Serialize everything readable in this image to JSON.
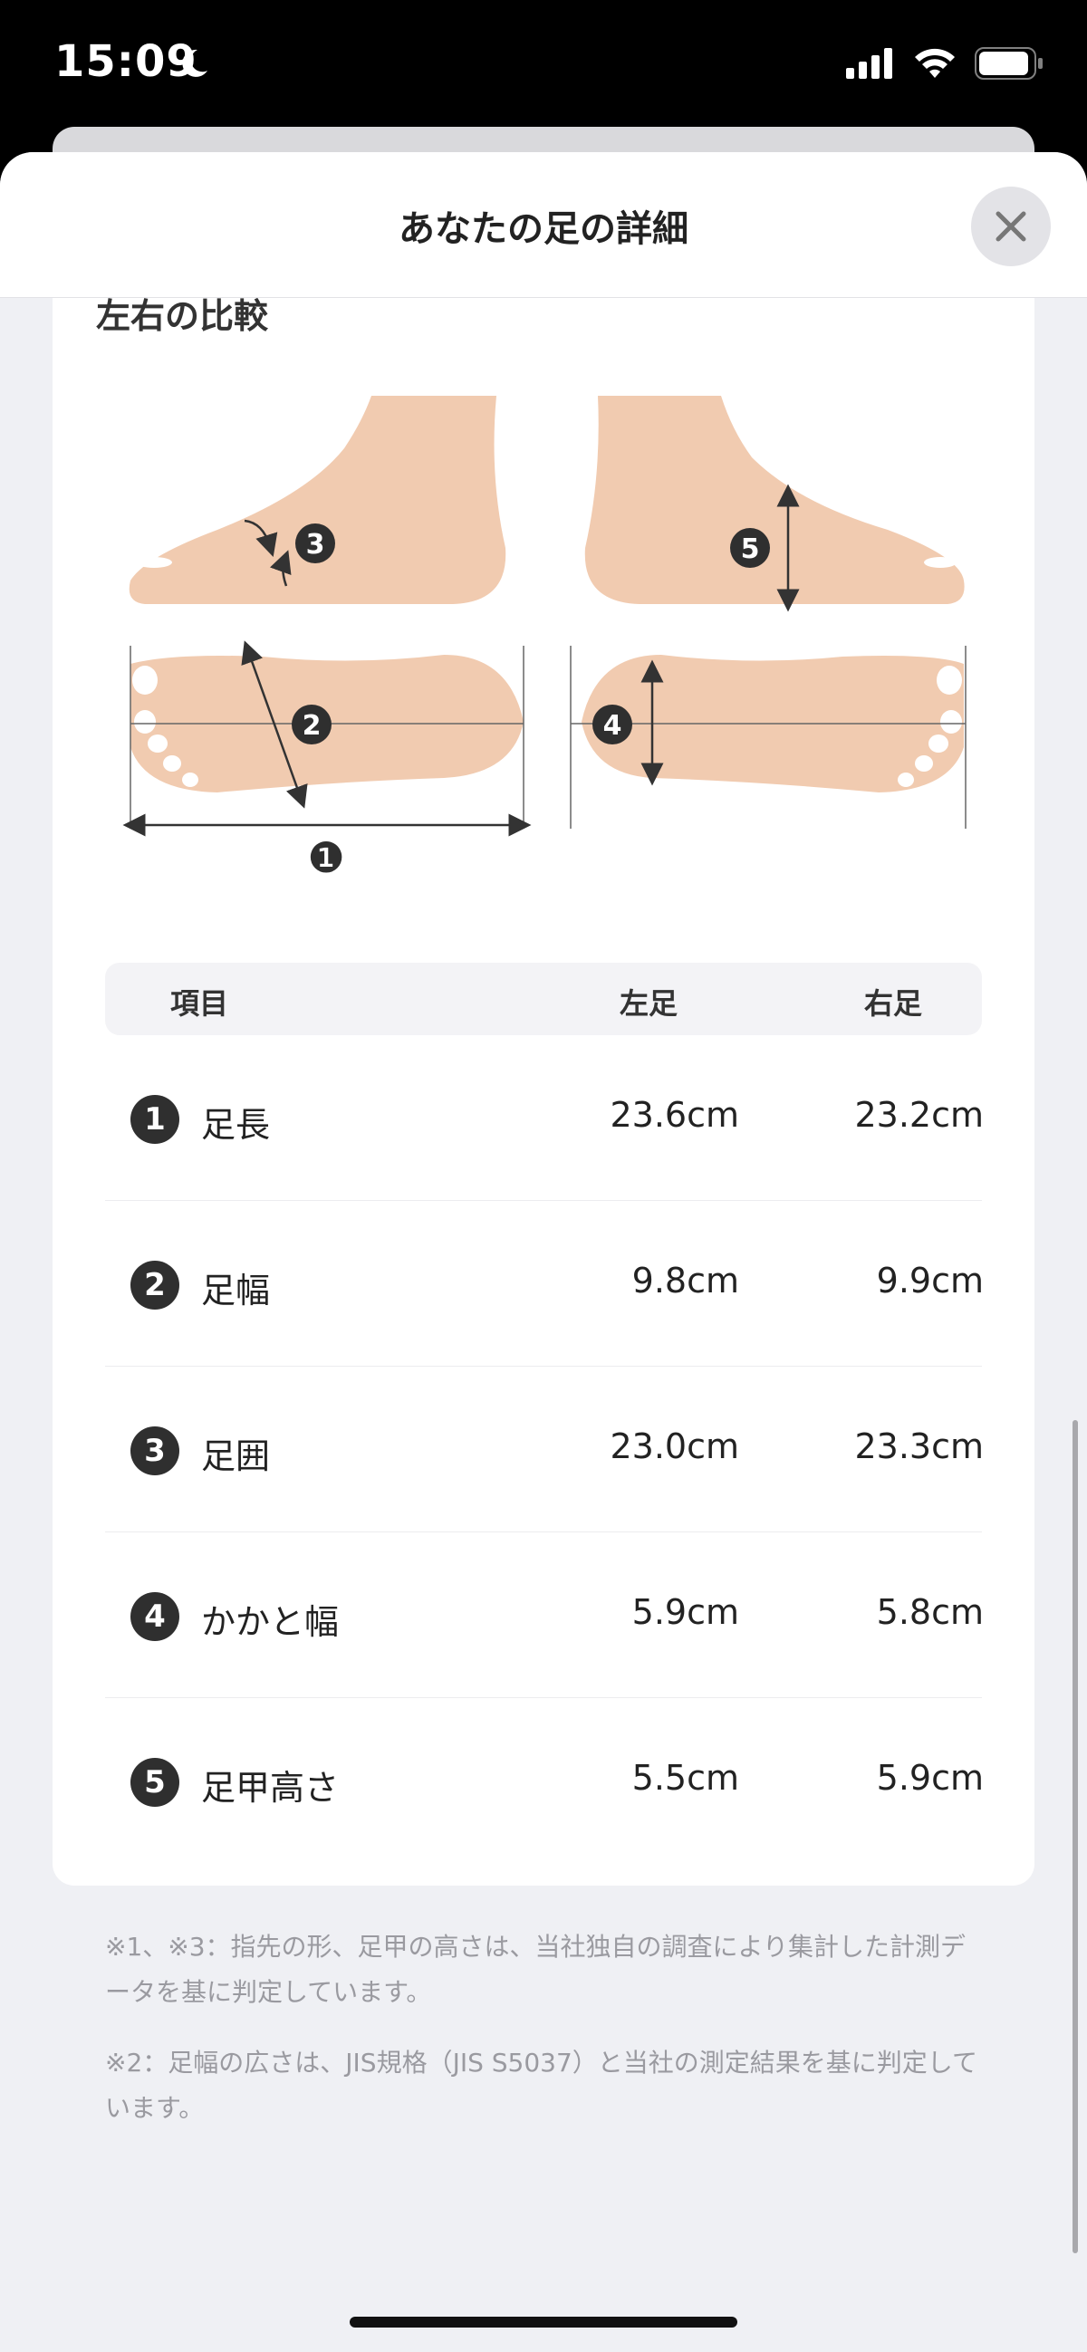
{
  "status_bar": {
    "time": "15:09"
  },
  "sheet": {
    "title": "あなたの足の詳細"
  },
  "section": {
    "heading": "左右の比較"
  },
  "diagram": {
    "markers": [
      "❶",
      "2",
      "3",
      "4",
      "5"
    ]
  },
  "table": {
    "headers": {
      "item": "項目",
      "left": "左足",
      "right": "右足"
    },
    "rows": [
      {
        "num": "1",
        "label": "足長",
        "left": "23.6cm",
        "right": "23.2cm"
      },
      {
        "num": "2",
        "label": "足幅",
        "left": "9.8cm",
        "right": "9.9cm"
      },
      {
        "num": "3",
        "label": "足囲",
        "left": "23.0cm",
        "right": "23.3cm"
      },
      {
        "num": "4",
        "label": "かかと幅",
        "left": "5.9cm",
        "right": "5.8cm"
      },
      {
        "num": "5",
        "label": "足甲高さ",
        "left": "5.5cm",
        "right": "5.9cm"
      }
    ]
  },
  "notes": [
    "※1、※3：指先の形、足甲の高さは、当社独自の調査により集計した計測データを基に判定しています。",
    "※2：足幅の広さは、JIS規格（JIS S5037）と当社の測定結果を基に判定しています。"
  ],
  "colors": {
    "skin": "#f1cbb0",
    "badge": "#2f2f2f",
    "note_text": "#9a9aa0"
  }
}
